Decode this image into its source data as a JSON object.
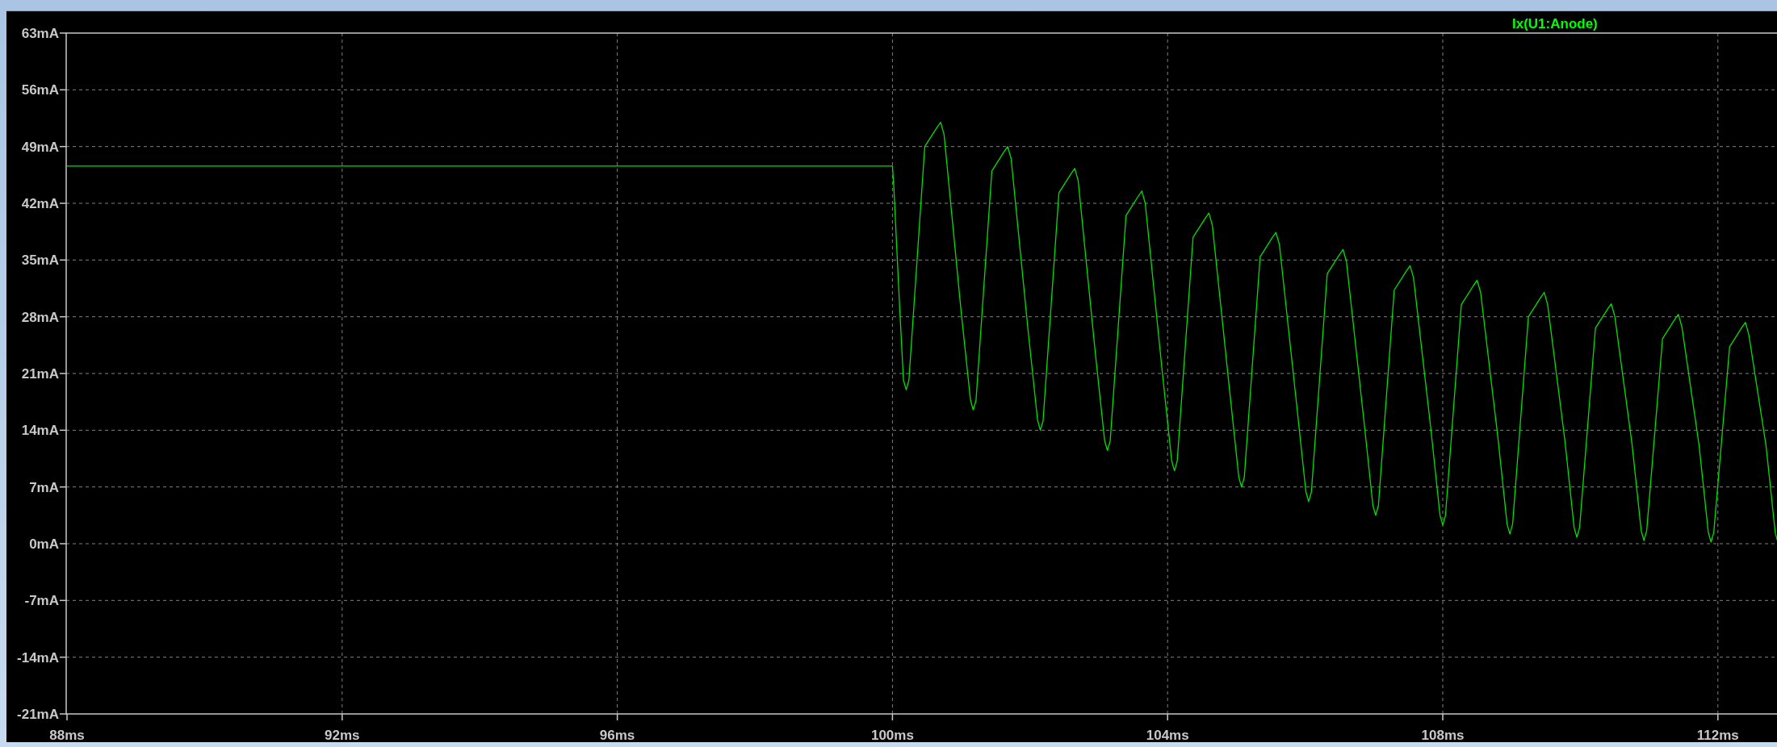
{
  "plot": {
    "trace_label": "Ix(U1:Anode)",
    "y_ticks": [
      "63mA",
      "56mA",
      "49mA",
      "42mA",
      "35mA",
      "28mA",
      "21mA",
      "14mA",
      "7mA",
      "0mA",
      "-7mA",
      "-14mA",
      "-21mA"
    ],
    "x_ticks": [
      "88ms",
      "92ms",
      "96ms",
      "100ms",
      "104ms",
      "108ms",
      "112ms"
    ]
  }
}
